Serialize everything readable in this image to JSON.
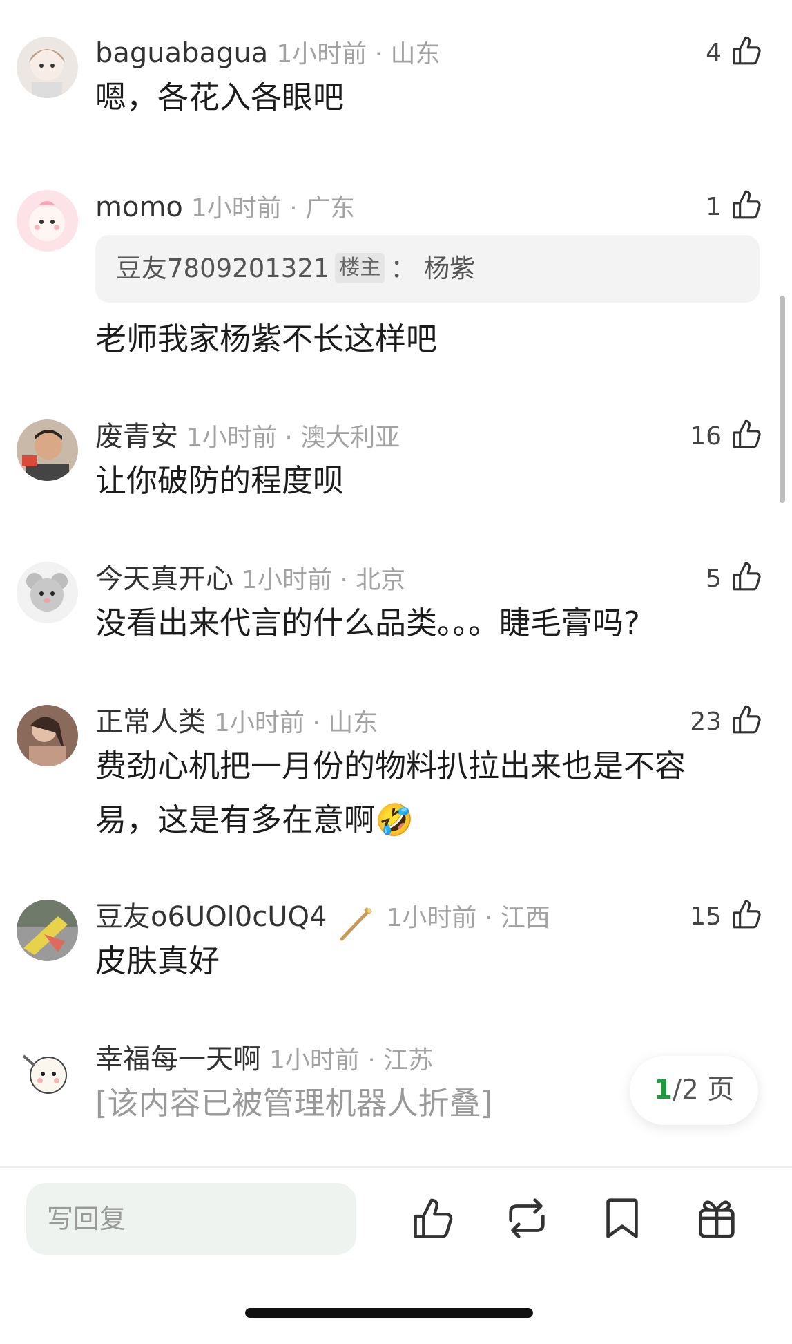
{
  "comments": [
    {
      "username": "baguabagua",
      "time": "1小时前 · 山东",
      "likes": "4",
      "text": "嗯，各花入各眼吧",
      "avatar": "girl-cartoon-avatar"
    },
    {
      "username": "momo",
      "time": "1小时前 · 广东",
      "likes": "1",
      "quote": {
        "user": "豆友7809201321",
        "tag": "楼主",
        "sep": "：",
        "text": "杨紫"
      },
      "text": "老师我家杨紫不长这样吧",
      "avatar": "pink-cartoon-avatar"
    },
    {
      "username": "废青安",
      "time": "1小时前 · 澳大利亚",
      "likes": "16",
      "text": "让你破防的程度呗",
      "avatar": "photo-avatar"
    },
    {
      "username": "今天真开心",
      "time": "1小时前 · 北京",
      "likes": "5",
      "text": "没看出来代言的什么品类。。。睫毛膏吗?",
      "avatar": "mouse-cartoon-avatar"
    },
    {
      "username": "正常人类",
      "time": "1小时前 · 山东",
      "likes": "23",
      "text": "费劲心机把一月份的物料扒拉出来也是不容易，这是有多在意啊",
      "emoji": "🤣",
      "avatar": "photo-avatar"
    },
    {
      "username": "豆友o6UOl0cUQ4",
      "time": "1小时前 · 江西",
      "likes": "15",
      "text": "皮肤真好",
      "avatar": "photo-avatar",
      "badge": "wand-badge-icon"
    },
    {
      "username": "幸福每一天啊",
      "time": "1小时前 · 江苏",
      "text": "[该内容已被管理机器人折叠]",
      "avatar": "dog-cartoon-avatar"
    }
  ],
  "pager": {
    "current": "1",
    "total": "/2",
    "unit": " 页"
  },
  "bottom_bar": {
    "reply_placeholder": "写回复",
    "icons": [
      "like-icon",
      "repost-icon",
      "bookmark-icon",
      "gift-icon"
    ]
  },
  "colors": {
    "accent": "#1a9b3c",
    "meta": "#a3a3a3",
    "input_bg": "#eef3f0"
  }
}
